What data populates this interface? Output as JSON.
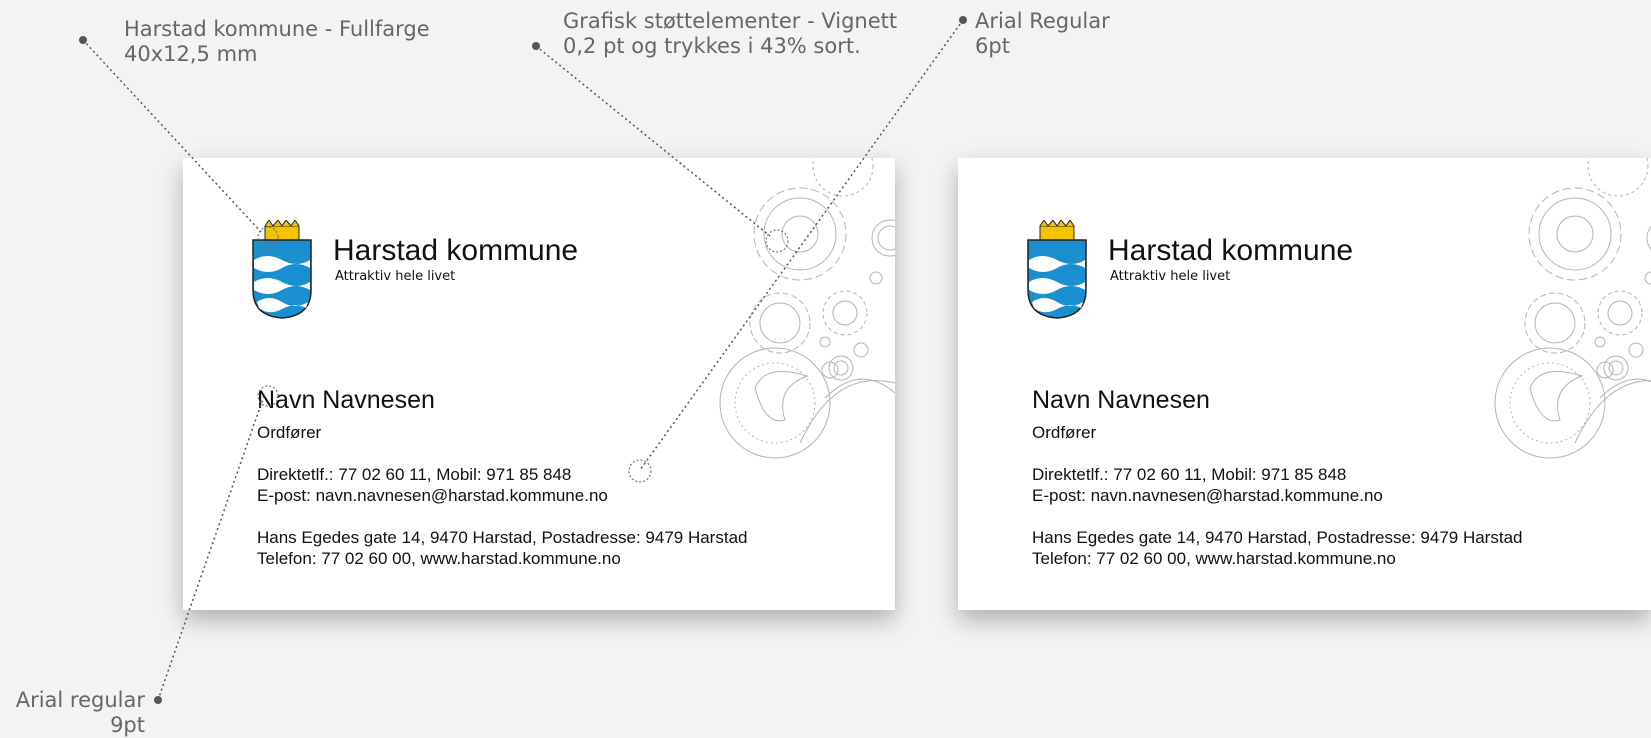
{
  "annotations": {
    "logo": {
      "line1": "Harstad kommune - Fullfarge",
      "line2": "40x12,5 mm"
    },
    "vignette": {
      "line1": "Grafisk støttelementer - Vignett",
      "line2": "0,2 pt og trykkes i 43% sort."
    },
    "small_font": {
      "line1": "Arial Regular",
      "line2": "6pt"
    },
    "body_font": {
      "line1": "Arial regular",
      "line2": "9pt"
    }
  },
  "cards": [
    {
      "org_name": "Harstad kommune",
      "slogan": "Attraktiv hele livet",
      "person_name": "Navn Navnesen",
      "role": "Ordfører",
      "direct_line": "Direktetlf.: 77 02 60 11, Mobil: 971 85 848",
      "email_line": "E-post: navn.navnesen@harstad.kommune.no",
      "address_line": "Hans Egedes gate 14, 9470 Harstad, Postadresse: 9479 Harstad",
      "phone_web_line": "Telefon: 77 02 60 00, www.harstad.kommune.no"
    },
    {
      "org_name": "Harstad kommune",
      "slogan": "Attraktiv hele livet",
      "person_name": "Navn Navnesen",
      "role": "Ordfører",
      "direct_line": "Direktetlf.: 77 02 60 11, Mobil: 971 85 848",
      "email_line": "E-post: navn.navnesen@harstad.kommune.no",
      "address_line": "Hans Egedes gate 14, 9470 Harstad, Postadresse: 9479 Harstad",
      "phone_web_line": "Telefon: 77 02 60 00, www.harstad.kommune.no"
    }
  ],
  "colors": {
    "crest_blue": "#1a8fd0",
    "crown_gold": "#f2c400",
    "vignette_gray": "#b4b4b4",
    "annotation_gray": "#666666"
  },
  "icons": [
    "coat-of-arms-icon",
    "gear-vignette-icon"
  ]
}
